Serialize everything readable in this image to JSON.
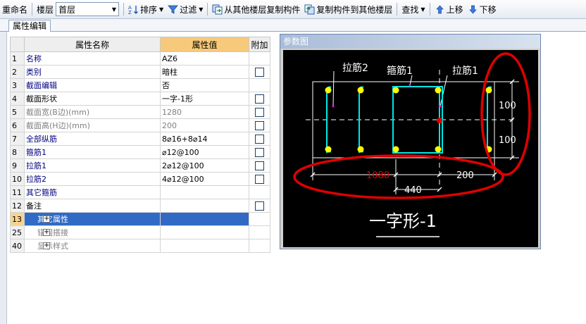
{
  "toolbar": {
    "rename": "重命名",
    "floor_label": "楼层",
    "floor_value": "首层",
    "sort": "排序",
    "filter": "过滤",
    "copy_from": "从其他楼层复制构件",
    "copy_to": "复制构件到其他楼层",
    "find": "查找",
    "move_up": "上移",
    "move_down": "下移"
  },
  "tab": {
    "label": "属性编辑"
  },
  "grid": {
    "headers": {
      "name": "属性名称",
      "value": "属性值",
      "extra": "附加"
    },
    "rows": [
      {
        "num": "1",
        "name": "名称",
        "value": "AZ6",
        "check": false
      },
      {
        "num": "2",
        "name": "类别",
        "value": "暗柱",
        "check": true
      },
      {
        "num": "3",
        "name": "截面编辑",
        "value": "否",
        "check": false
      },
      {
        "num": "4",
        "name": "截面形状",
        "value": "一字-1形",
        "check": true
      },
      {
        "num": "5",
        "name": "截面宽(B边)(mm)",
        "value": "1280",
        "check": true
      },
      {
        "num": "6",
        "name": "截面高(H边)(mm)",
        "value": "200",
        "check": true
      },
      {
        "num": "7",
        "name": "全部纵筋",
        "value": "8⌀16+8⌀14",
        "check": true
      },
      {
        "num": "8",
        "name": "箍筋1",
        "value": "⌀12@100",
        "check": true
      },
      {
        "num": "9",
        "name": "拉筋1",
        "value": "2⌀12@100",
        "check": true
      },
      {
        "num": "10",
        "name": "拉筋2",
        "value": "4⌀12@100",
        "check": true
      },
      {
        "num": "11",
        "name": "其它箍筋",
        "value": "",
        "check": false
      },
      {
        "num": "12",
        "name": "备注",
        "value": "",
        "check": true
      },
      {
        "num": "13",
        "name": "其它属性",
        "value": "",
        "check": false
      },
      {
        "num": "25",
        "name": "锚固搭接",
        "value": "",
        "check": false
      },
      {
        "num": "40",
        "name": "显示样式",
        "value": "",
        "check": false
      }
    ]
  },
  "panel": {
    "title": "参数图"
  },
  "diagram": {
    "label_tie2": "拉筋2",
    "label_stirrup1": "箍筋1",
    "label_tie1": "拉筋1",
    "dim_100_top": "100",
    "dim_100_bottom": "100",
    "dim_1080": "1080",
    "dim_200": "200",
    "dim_440": "440",
    "shape_name": "一字形-1"
  },
  "colors": {
    "accent_red": "#e00000",
    "cyan": "#00e5e5",
    "rebar": "#ffff00",
    "selection": "#316ac5",
    "header_value": "#f7c97a"
  }
}
